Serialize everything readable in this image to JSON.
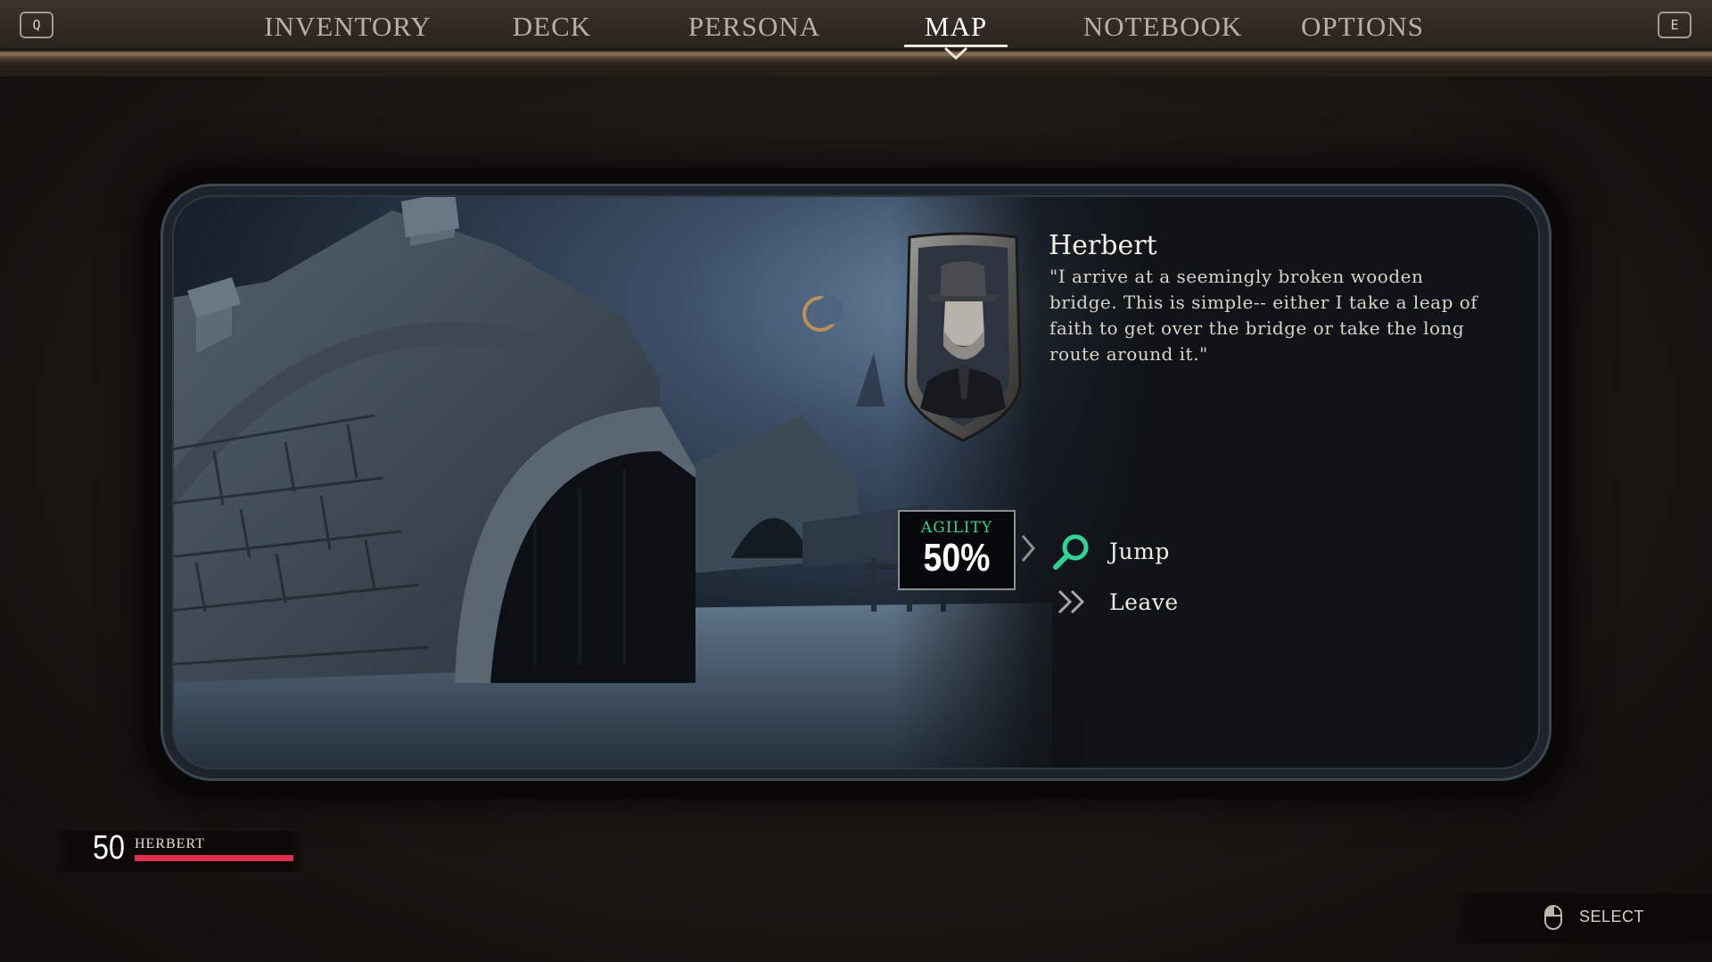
{
  "nav": {
    "left_key": "Q",
    "right_key": "E",
    "tabs": [
      {
        "label": "INVENTORY"
      },
      {
        "label": "DECK"
      },
      {
        "label": "PERSONA"
      },
      {
        "label": "MAP",
        "active": true
      },
      {
        "label": "NOTEBOOK"
      },
      {
        "label": "OPTIONS"
      }
    ]
  },
  "event": {
    "speaker": "Herbert",
    "quote": "\"I arrive at a seemingly broken wooden bridge. This is simple-- either I take a leap of faith to get over the bridge or take the long route around it.\"",
    "skill_check": {
      "skill": "AGILITY",
      "chance": "50%"
    },
    "choices": [
      {
        "label": "Jump",
        "icon": "magnifier-icon"
      },
      {
        "label": "Leave",
        "icon": "double-chevron-icon"
      }
    ]
  },
  "character": {
    "name": "HERBERT",
    "health": "50",
    "health_fraction": 1.0
  },
  "controls": {
    "select_label": "SELECT",
    "select_icon": "mouse-icon"
  },
  "colors": {
    "skill_accent": "#2fd596",
    "health_bar": "#e03050"
  }
}
